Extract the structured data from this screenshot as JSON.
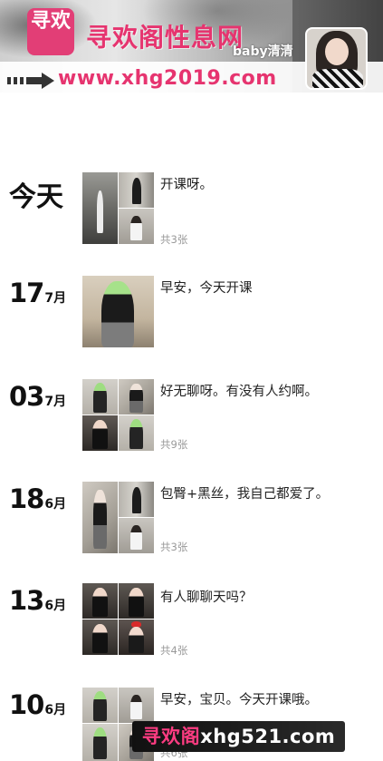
{
  "header": {
    "logo_text": "寻欢",
    "site_title": "寻欢阁性息网",
    "nickname": "baby清清",
    "url": "www.xhg2019.com",
    "accent_color": "#e6346f"
  },
  "avatar": {
    "icon": "profile-photo"
  },
  "timeline": [
    {
      "day": "今天",
      "month": "",
      "text": "开课呀。",
      "count": "共3张"
    },
    {
      "day": "17",
      "month": "7月",
      "text": "早安，今天开课",
      "count": ""
    },
    {
      "day": "03",
      "month": "7月",
      "text": "好无聊呀。有没有人约啊。",
      "count": "共9张"
    },
    {
      "day": "18",
      "month": "6月",
      "text": "包臀+黑丝，我自己都爱了。",
      "count": "共3张"
    },
    {
      "day": "13",
      "month": "6月",
      "text": "有人聊聊天吗？",
      "count": "共4张"
    },
    {
      "day": "10",
      "month": "6月",
      "text": "早安，宝贝。今天开课哦。",
      "count": "共6张"
    }
  ],
  "watermark": {
    "prefix": "寻欢阁",
    "domain": "xhg521.com"
  }
}
